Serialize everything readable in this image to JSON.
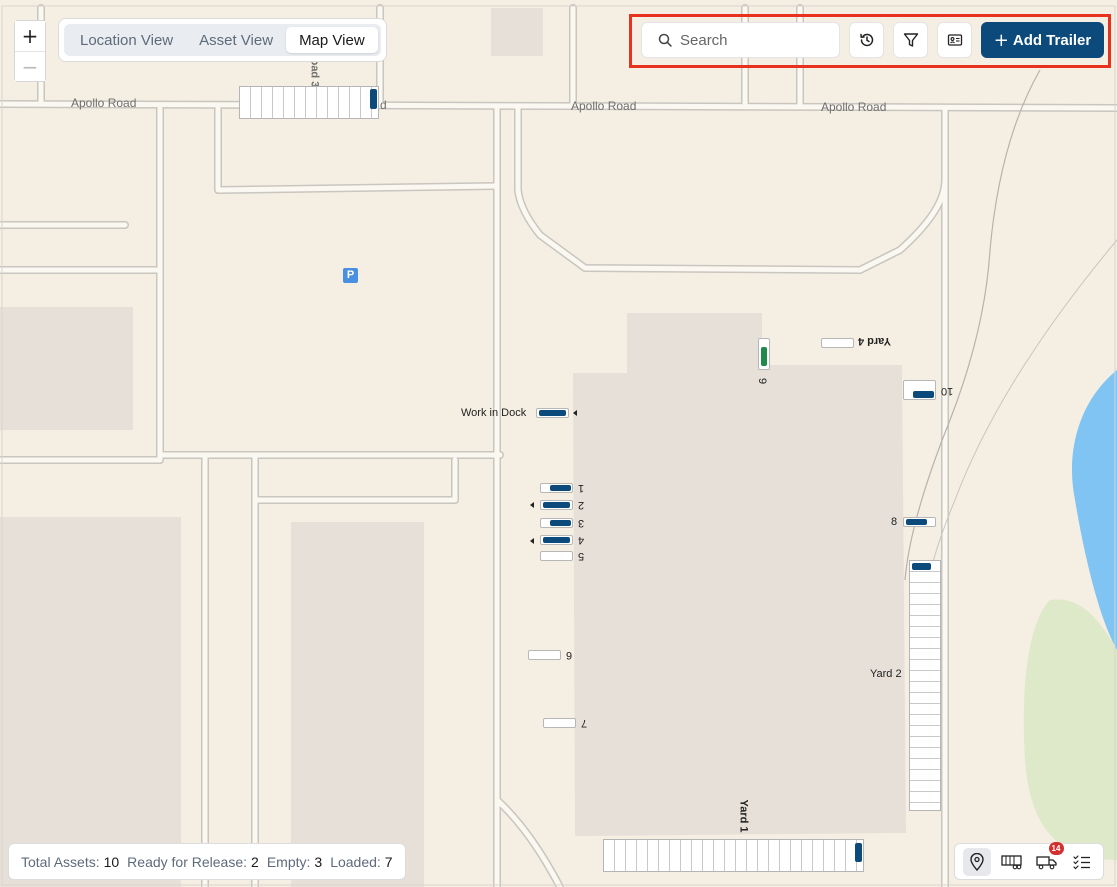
{
  "colors": {
    "accent": "#0d4a7c",
    "highlight_box": "#e8321e",
    "trailer": "#0d4a7c",
    "trailer_green": "#1f8a4c",
    "water": "#7fc4f2",
    "park": "#dde9c8"
  },
  "zoom": {
    "in_label": "+",
    "out_label": "−"
  },
  "views": {
    "tabs": [
      {
        "label": "Location View"
      },
      {
        "label": "Asset View"
      },
      {
        "label": "Map View"
      }
    ],
    "active": "Map View"
  },
  "search": {
    "placeholder": "Search",
    "value": ""
  },
  "toolbar": {
    "history_icon": "history-icon",
    "filter_icon": "filter-icon",
    "id_card_icon": "id-card-icon",
    "add_label": "Add Trailer"
  },
  "map": {
    "roads": {
      "apollo_1": "Apollo Road",
      "apollo_2": "Apollo Road",
      "apollo_3": "Apollo Road",
      "road_d3": "Road 3",
      "road_d": "d"
    },
    "parking_label": "P",
    "work_in_dock": "Work in Dock",
    "doors": {
      "d1": "1",
      "d2": "2",
      "d3": "3",
      "d4": "4",
      "d5": "5",
      "d6": "6",
      "d7": "7",
      "d8": "8",
      "d9": "9",
      "d10": "10"
    },
    "yards": {
      "yard1": "Yard 1",
      "yard2": "Yard 2",
      "yard4": "Yard 4"
    }
  },
  "stats": {
    "total_label": "Total Assets:",
    "total": "10",
    "ready_label": "Ready for Release:",
    "ready": "2",
    "empty_label": "Empty:",
    "empty": "3",
    "loaded_label": "Loaded:",
    "loaded": "7"
  },
  "iconbar": {
    "items": [
      {
        "icon": "location-pin-icon"
      },
      {
        "icon": "trailer-icon"
      },
      {
        "icon": "truck-icon",
        "badge": "14"
      },
      {
        "icon": "checklist-icon"
      }
    ]
  }
}
